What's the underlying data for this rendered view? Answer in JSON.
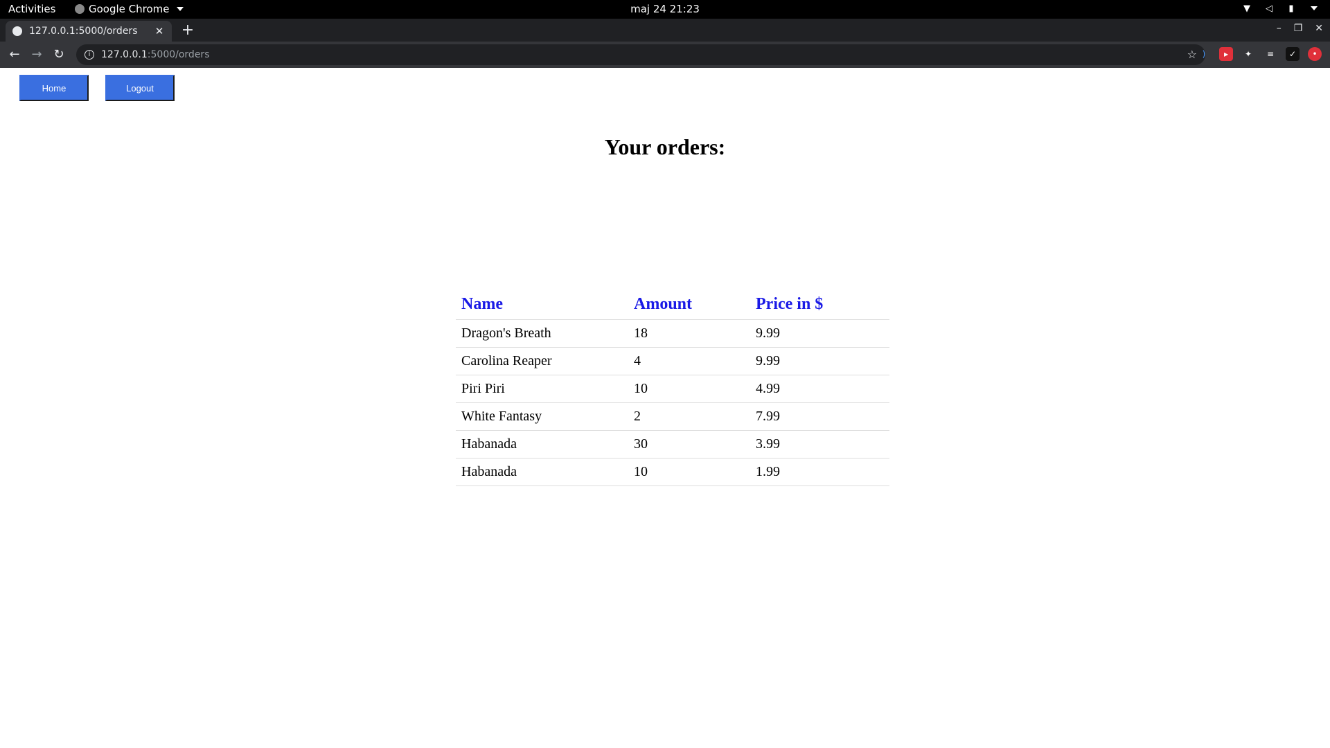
{
  "system": {
    "activities": "Activities",
    "app_name": "Google Chrome",
    "clock": "maj 24  21:23"
  },
  "browser": {
    "tab_title": "127.0.0.1:5000/orders",
    "url_host": "127.0.0.1",
    "url_path": ":5000/orders"
  },
  "nav": {
    "home_label": "Home",
    "logout_label": "Logout"
  },
  "page": {
    "title": "Your orders:"
  },
  "table": {
    "headers": [
      "Name",
      "Amount",
      "Price in $"
    ],
    "rows": [
      {
        "name": "Dragon's Breath",
        "amount": "18",
        "price": "9.99"
      },
      {
        "name": "Carolina Reaper",
        "amount": "4",
        "price": "9.99"
      },
      {
        "name": "Piri Piri",
        "amount": "10",
        "price": "4.99"
      },
      {
        "name": "White Fantasy",
        "amount": "2",
        "price": "7.99"
      },
      {
        "name": "Habanada",
        "amount": "30",
        "price": "3.99"
      },
      {
        "name": "Habanada",
        "amount": "10",
        "price": "1.99"
      }
    ]
  },
  "colors": {
    "button_bg": "#3a6fe0",
    "header_text": "#1a1ae6"
  }
}
